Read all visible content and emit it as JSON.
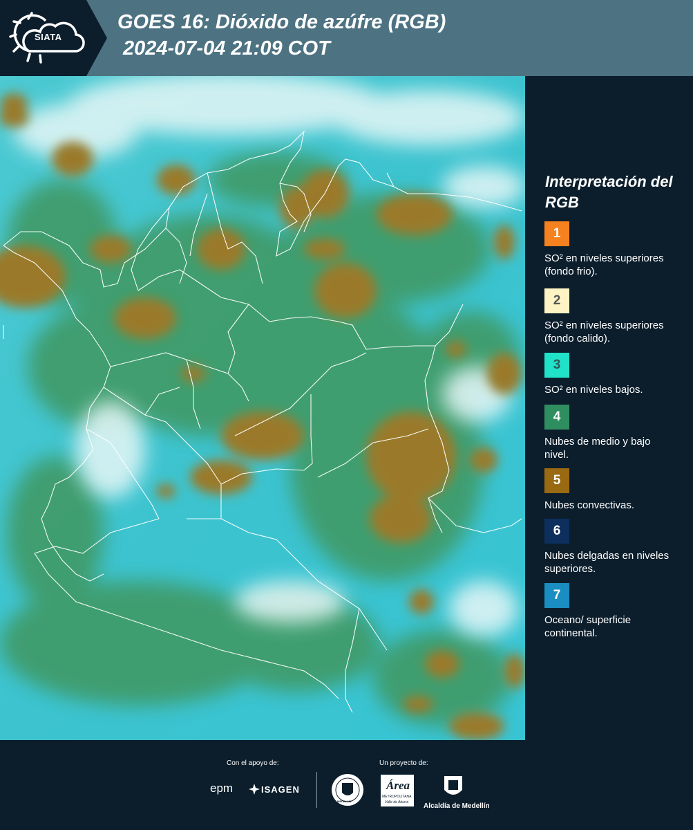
{
  "header": {
    "brand": "SIATA",
    "title_line1": "GOES 16: Dióxido de azúfre (RGB)",
    "title_line2": "2024-07-04 21:09 COT",
    "colors": {
      "band": "#4d7282",
      "logo_band": "#0c1e2c"
    }
  },
  "map": {
    "icon": "satellite-rgb-image",
    "colors": {
      "ocean": "#37c6d6",
      "land_cloud": "#3d9a6a",
      "convective": "#9a7a2c",
      "borders": "#ffffff"
    }
  },
  "legend": {
    "title": "Interpretación del RGB",
    "items": [
      {
        "num": "1",
        "color": "#f5811f",
        "text": "SO² en niveles superiores (fondo frio)."
      },
      {
        "num": "2",
        "color": "#fdf3c3",
        "text": "SO² en niveles superiores (fondo calido)."
      },
      {
        "num": "3",
        "color": "#20e2c8",
        "text": "SO² en niveles bajos."
      },
      {
        "num": "4",
        "color": "#2f8e60",
        "text": "Nubes de medio y bajo nivel."
      },
      {
        "num": "5",
        "color": "#9a6a12",
        "text": "Nubes convectivas."
      },
      {
        "num": "6",
        "color": "#0c2f5e",
        "text": "Nubes delgadas en niveles superiores."
      },
      {
        "num": "7",
        "color": "#1a8ec0",
        "text": "Oceano/ superficie continental."
      }
    ]
  },
  "footer": {
    "support_label": "Con el apoyo de:",
    "project_label": "Un proyecto de:",
    "epm": "epm",
    "isagen": "ISAGEN",
    "medellin_seal": "MEDELLÍN",
    "area": "Área",
    "area_sub": "METROPOLITANA",
    "area_sub2": "Valle de Aburrá",
    "alcaldia": "Alcaldía de Medellín"
  }
}
